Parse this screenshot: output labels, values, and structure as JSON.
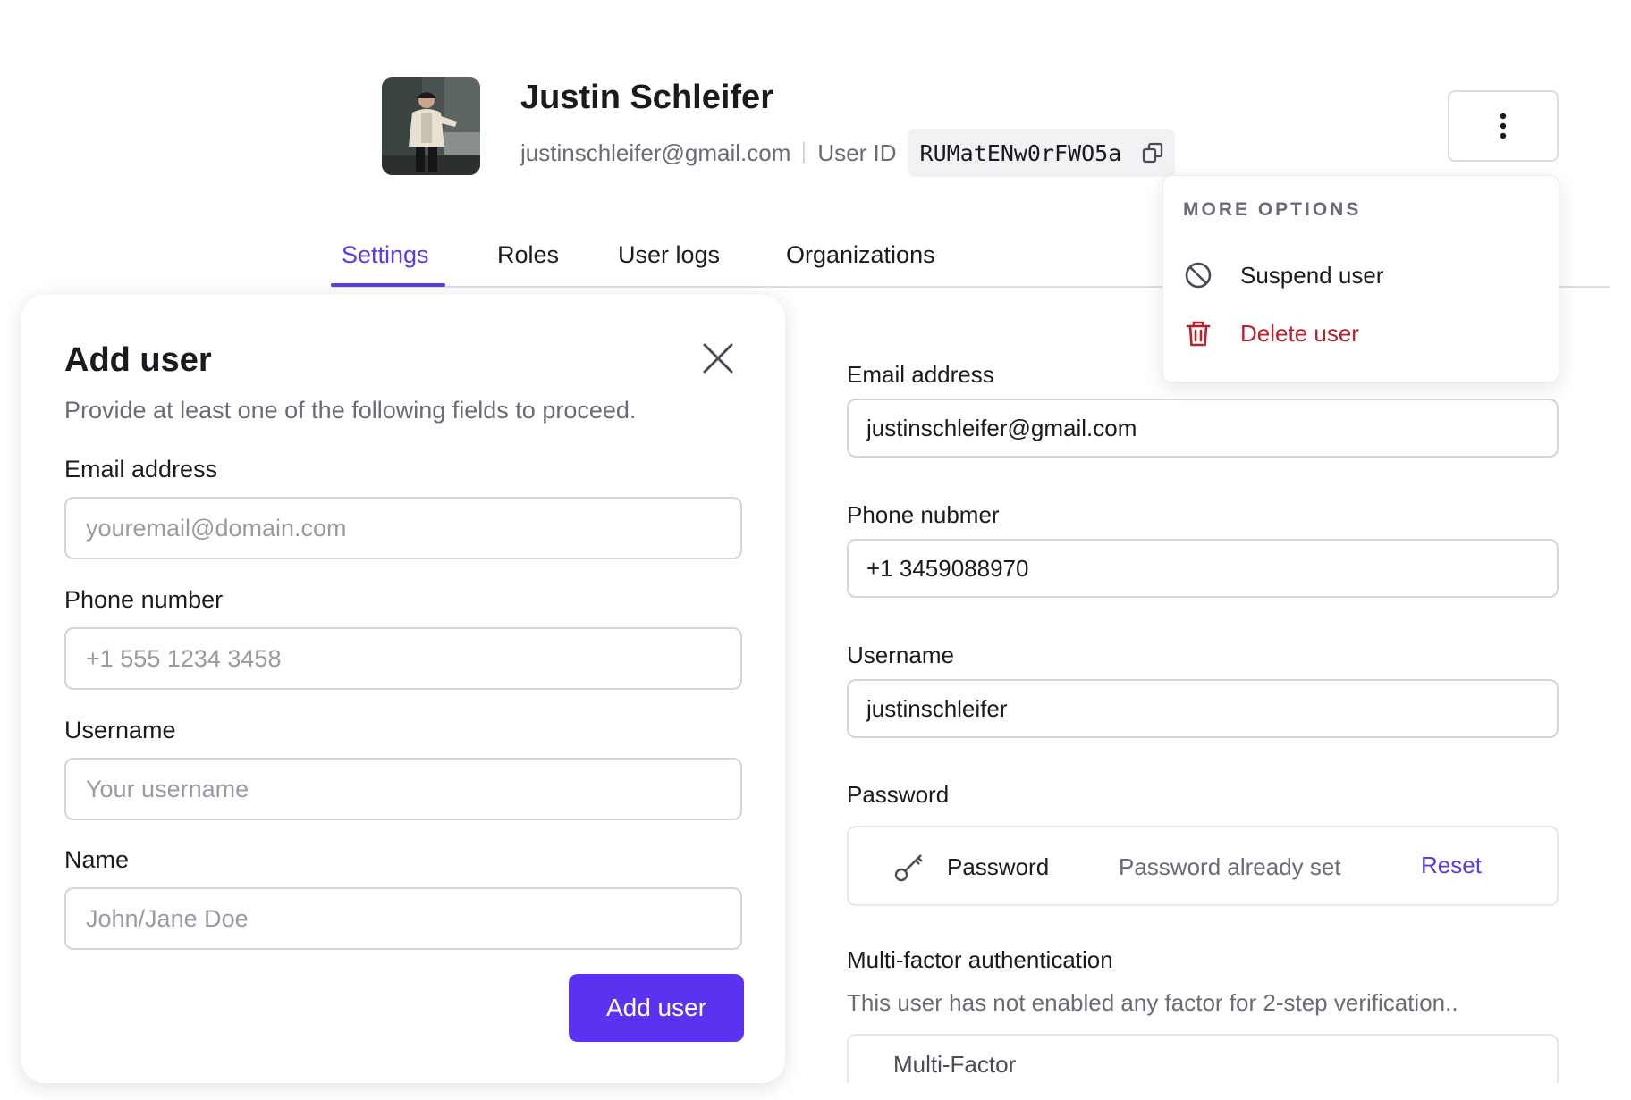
{
  "user": {
    "name": "Justin Schleifer",
    "email": "justinschleifer@gmail.com",
    "user_id_label": "User ID",
    "user_id": "RUMatENw0rFWO5a"
  },
  "tabs": [
    {
      "label": "Settings",
      "active": true
    },
    {
      "label": "Roles",
      "active": false
    },
    {
      "label": "User logs",
      "active": false
    },
    {
      "label": "Organizations",
      "active": false
    }
  ],
  "more_options": {
    "title": "MORE OPTIONS",
    "items": [
      {
        "label": "Suspend user",
        "icon": "ban-icon"
      },
      {
        "label": "Delete user",
        "icon": "trash-icon",
        "color": "#b8202b"
      }
    ]
  },
  "settings_form": {
    "email_label": "Email address",
    "email_value": "justinschleifer@gmail.com",
    "phone_label": "Phone nubmer",
    "phone_value": "+1 3459088970",
    "username_label": "Username",
    "username_value": "justinschleifer",
    "password_label": "Password",
    "password_row": {
      "name": "Password",
      "status": "Password already set",
      "action": "Reset"
    },
    "mfa_label": "Multi-factor authentication",
    "mfa_description": "This user has not enabled any factor for 2-step verification..",
    "mfa_box_label": "Multi-Factor"
  },
  "add_user_modal": {
    "title": "Add user",
    "subtitle": "Provide at least one of the following fields to proceed.",
    "email_label": "Email address",
    "email_placeholder": "youremail@domain.com",
    "phone_label": "Phone number",
    "phone_placeholder": "+1 555 1234 3458",
    "username_label": "Username",
    "username_placeholder": "Your username",
    "name_label": "Name",
    "name_placeholder": "John/Jane Doe",
    "submit_label": "Add user"
  },
  "colors": {
    "accent": "#5b3ce6",
    "button": "#5b32f0",
    "danger": "#b8202b"
  }
}
